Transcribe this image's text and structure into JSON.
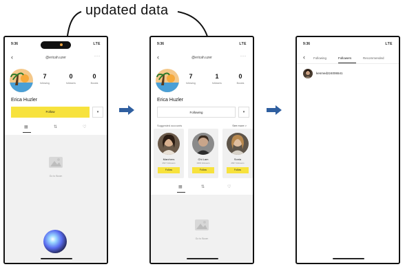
{
  "caption": "updated data",
  "profile": {
    "handle": "@ericah.uzer",
    "name": "Erica Huzler",
    "stats": [
      {
        "label": "following"
      },
      {
        "label": "followers"
      },
      {
        "label": "Boosts"
      }
    ]
  },
  "screen1": {
    "time": "9:36",
    "status_right": "LTE",
    "stat_values": [
      "7",
      "0",
      "0"
    ],
    "follow_label": "Follow",
    "dropdown": "▾",
    "empty_text": "Go to Boom"
  },
  "screen2": {
    "time": "9:36",
    "status_right": "LTE",
    "stat_values": [
      "7",
      "1",
      "0"
    ],
    "follow_label": "Following",
    "dropdown": "▾",
    "suggested_heading": "Suggested accounts",
    "see_all": "See more >",
    "cards": [
      {
        "name": "Marchers",
        "sub": "2647 followers",
        "button": "Follow"
      },
      {
        "name": "Chi Lam",
        "sub": "1909 followers",
        "button": "Follow"
      },
      {
        "name": "Sonia",
        "sub": "2847 followers",
        "button": "Follow"
      }
    ],
    "empty_text": "Go to Boom"
  },
  "screen3": {
    "time": "9:36",
    "status_right": "LTE",
    "tabs": [
      "Following",
      "Followers",
      "Recommended"
    ],
    "active_tab": "Followers",
    "follower": "kenmed224006541"
  },
  "colors": {
    "accent_yellow": "#f7e23d",
    "arrow_blue": "#2f5fa0",
    "frame": "#111111",
    "empty_bg": "#f1f1f1"
  },
  "icons": [
    "back-arrow-icon",
    "more-icon",
    "grid-icon",
    "repost-icon",
    "like-icon",
    "empty-photo-icon",
    "siri-icon",
    "right-arrow-icon"
  ]
}
